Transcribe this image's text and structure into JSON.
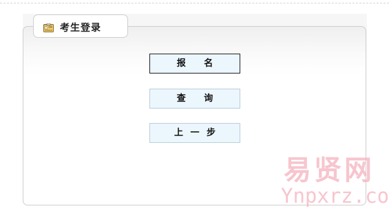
{
  "panel": {
    "title": "考生登录",
    "icon": "id-card-icon"
  },
  "buttons": {
    "register": "报 名",
    "query": "查 询",
    "back": "上 一 步"
  },
  "watermark": {
    "chinese": "易贤网",
    "latin": "Ynpxrz.com"
  },
  "colors": {
    "button_background": "#ecf6fd",
    "button_border": "#b9cfdb",
    "primary_button_border": "#222222",
    "panel_border": "#cfcfcf",
    "watermark": "#f4b2be"
  }
}
